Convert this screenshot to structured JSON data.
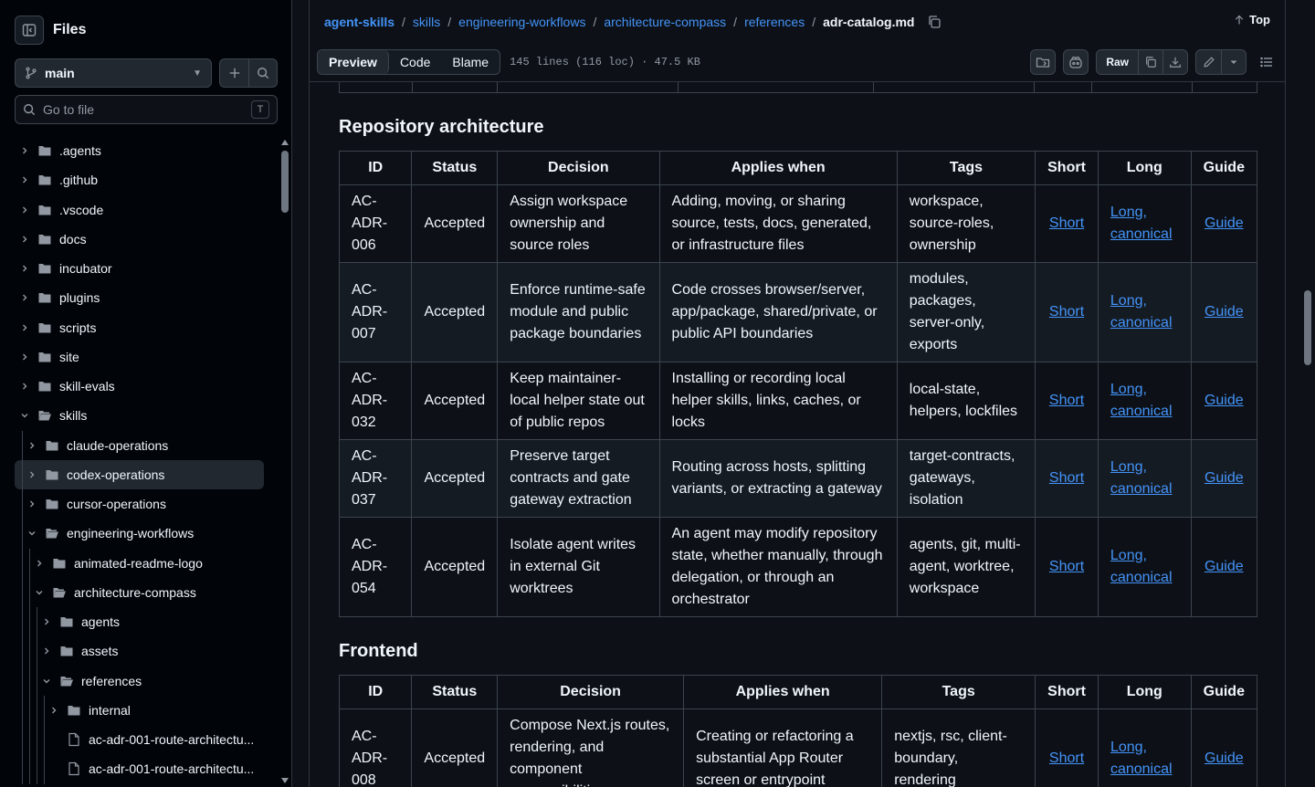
{
  "sidebar": {
    "title": "Files",
    "branch": "main",
    "goto_placeholder": "Go to file",
    "goto_shortcut": "T",
    "tree": [
      {
        "label": ".agents",
        "depth": 0,
        "expanded": false,
        "type": "folder"
      },
      {
        "label": ".github",
        "depth": 0,
        "expanded": false,
        "type": "folder"
      },
      {
        "label": ".vscode",
        "depth": 0,
        "expanded": false,
        "type": "folder"
      },
      {
        "label": "docs",
        "depth": 0,
        "expanded": false,
        "type": "folder"
      },
      {
        "label": "incubator",
        "depth": 0,
        "expanded": false,
        "type": "folder"
      },
      {
        "label": "plugins",
        "depth": 0,
        "expanded": false,
        "type": "folder"
      },
      {
        "label": "scripts",
        "depth": 0,
        "expanded": false,
        "type": "folder"
      },
      {
        "label": "site",
        "depth": 0,
        "expanded": false,
        "type": "folder"
      },
      {
        "label": "skill-evals",
        "depth": 0,
        "expanded": false,
        "type": "folder"
      },
      {
        "label": "skills",
        "depth": 0,
        "expanded": true,
        "type": "folder"
      },
      {
        "label": "claude-operations",
        "depth": 1,
        "expanded": false,
        "type": "folder"
      },
      {
        "label": "codex-operations",
        "depth": 1,
        "expanded": false,
        "type": "folder",
        "selected": true
      },
      {
        "label": "cursor-operations",
        "depth": 1,
        "expanded": false,
        "type": "folder"
      },
      {
        "label": "engineering-workflows",
        "depth": 1,
        "expanded": true,
        "type": "folder"
      },
      {
        "label": "animated-readme-logo",
        "depth": 2,
        "expanded": false,
        "type": "folder"
      },
      {
        "label": "architecture-compass",
        "depth": 2,
        "expanded": true,
        "type": "folder"
      },
      {
        "label": "agents",
        "depth": 3,
        "expanded": false,
        "type": "folder"
      },
      {
        "label": "assets",
        "depth": 3,
        "expanded": false,
        "type": "folder"
      },
      {
        "label": "references",
        "depth": 3,
        "expanded": true,
        "type": "folder"
      },
      {
        "label": "internal",
        "depth": 4,
        "expanded": false,
        "type": "folder"
      },
      {
        "label": "ac-adr-001-route-architectu...",
        "depth": 4,
        "type": "file"
      },
      {
        "label": "ac-adr-001-route-architectu...",
        "depth": 4,
        "type": "file"
      }
    ]
  },
  "breadcrumb": {
    "items": [
      "agent-skills",
      "skills",
      "engineering-workflows",
      "architecture-compass",
      "references"
    ],
    "current": "adr-catalog.md"
  },
  "top_label": "Top",
  "toolbar": {
    "tabs": [
      "Preview",
      "Code",
      "Blame"
    ],
    "active_tab": "Preview",
    "meta": "145 lines (116 loc) · 47.5 KB",
    "raw_label": "Raw"
  },
  "columns": [
    "ID",
    "Status",
    "Decision",
    "Applies when",
    "Tags",
    "Short",
    "Long",
    "Guide"
  ],
  "sections": [
    {
      "title": "Repository architecture",
      "rows": [
        {
          "id": "AC-ADR-006",
          "status": "Accepted",
          "decision": "Assign workspace ownership and source roles",
          "applies": "Adding, moving, or sharing source, tests, docs, generated, or infrastructure files",
          "tags": "workspace, source-roles, ownership",
          "short": "Short",
          "long": "Long, canonical",
          "guide": "Guide"
        },
        {
          "id": "AC-ADR-007",
          "status": "Accepted",
          "decision": "Enforce runtime-safe module and public package boundaries",
          "applies": "Code crosses browser/server, app/package, shared/private, or public API boundaries",
          "tags": "modules, packages, server-only, exports",
          "short": "Short",
          "long": "Long, canonical",
          "guide": "Guide"
        },
        {
          "id": "AC-ADR-032",
          "status": "Accepted",
          "decision": "Keep maintainer-local helper state out of public repos",
          "applies": "Installing or recording local helper skills, links, caches, or locks",
          "tags": "local-state, helpers, lockfiles",
          "short": "Short",
          "long": "Long, canonical",
          "guide": "Guide"
        },
        {
          "id": "AC-ADR-037",
          "status": "Accepted",
          "decision": "Preserve target contracts and gate gateway extraction",
          "applies": "Routing across hosts, splitting variants, or extracting a gateway",
          "tags": "target-contracts, gateways, isolation",
          "short": "Short",
          "long": "Long, canonical",
          "guide": "Guide"
        },
        {
          "id": "AC-ADR-054",
          "status": "Accepted",
          "decision": "Isolate agent writes in external Git worktrees",
          "applies": "An agent may modify repository state, whether manually, through delegation, or through an orchestrator",
          "tags": "agents, git, multi-agent, worktree, workspace",
          "short": "Short",
          "long": "Long, canonical",
          "guide": "Guide"
        }
      ]
    },
    {
      "title": "Frontend",
      "rows": [
        {
          "id": "AC-ADR-008",
          "status": "Accepted",
          "decision": "Compose Next.js routes, rendering, and component responsibilities",
          "applies": "Creating or refactoring a substantial App Router screen or entrypoint",
          "tags": "nextjs, rsc, client-boundary, rendering",
          "short": "Short",
          "long": "Long, canonical",
          "guide": "Guide"
        }
      ]
    }
  ],
  "colors": {
    "background": "#0d1117",
    "sidebar": "#010409",
    "border": "#3d444d",
    "link": "#4493f8",
    "text": "#f0f6fc",
    "muted": "#9198a1"
  }
}
